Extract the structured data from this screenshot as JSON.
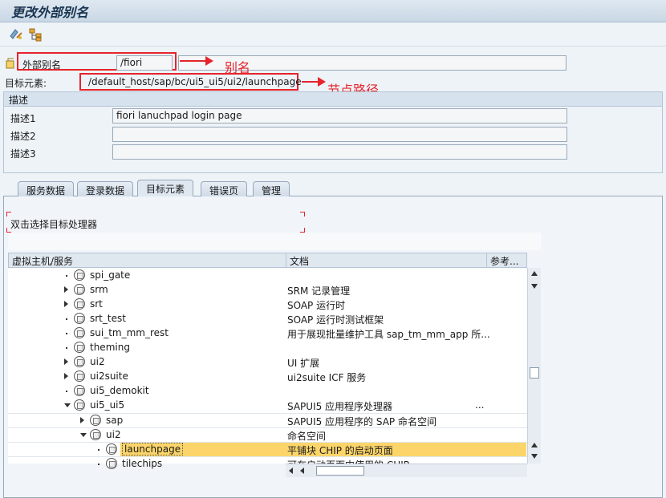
{
  "window": {
    "title": "更改外部别名"
  },
  "toolbar": {
    "icons": [
      "display-change-icon",
      "hierarchy-icon"
    ]
  },
  "alias": {
    "label": "外部别名",
    "value": "/fiori",
    "annotation": "别名"
  },
  "target": {
    "label": "目标元素:",
    "value": "/default_host/sap/bc/ui5_ui5/ui2/launchpage",
    "annotation": "节点路径"
  },
  "description": {
    "header": "描述",
    "rows": [
      {
        "label": "描述1",
        "value": "fiori lanuchpad login page"
      },
      {
        "label": "描述2",
        "value": ""
      },
      {
        "label": "描述3",
        "value": ""
      }
    ]
  },
  "tabs": [
    {
      "label": "服务数据",
      "active": false
    },
    {
      "label": "登录数据",
      "active": false
    },
    {
      "label": "目标元素",
      "active": true
    },
    {
      "label": "错误页",
      "active": false
    },
    {
      "label": "管理",
      "active": false
    }
  ],
  "panel": {
    "instruction": "双击选择目标处理器",
    "columns": [
      "虚拟主机/服务",
      "文档",
      "参考..."
    ],
    "tree": [
      {
        "name": "spi_gate",
        "doc": "",
        "level": 0,
        "toggle": "none"
      },
      {
        "name": "srm",
        "doc": "SRM 记录管理",
        "level": 0,
        "toggle": "collapsed"
      },
      {
        "name": "srt",
        "doc": "SOAP 运行时",
        "level": 0,
        "toggle": "collapsed"
      },
      {
        "name": "srt_test",
        "doc": "SOAP 运行时测试框架",
        "level": 0,
        "toggle": "none"
      },
      {
        "name": "sui_tm_mm_rest",
        "doc": "用于展现批量维护工具 sap_tm_mm_app 所...",
        "level": 0,
        "toggle": "none"
      },
      {
        "name": "theming",
        "doc": "",
        "level": 0,
        "toggle": "none"
      },
      {
        "name": "ui2",
        "doc": "UI 扩展",
        "level": 0,
        "toggle": "collapsed"
      },
      {
        "name": "ui2suite",
        "doc": "ui2suite ICF 服务",
        "level": 0,
        "toggle": "collapsed"
      },
      {
        "name": "ui5_demokit",
        "doc": "",
        "level": 0,
        "toggle": "none"
      },
      {
        "name": "ui5_ui5",
        "doc": "SAPUI5 应用程序处理器",
        "level": 0,
        "toggle": "expanded"
      },
      {
        "name": "sap",
        "doc": "SAPUI5 应用程序的 SAP 命名空间",
        "level": 1,
        "toggle": "collapsed"
      },
      {
        "name": "ui2",
        "doc": "命名空间",
        "level": 1,
        "toggle": "expanded"
      },
      {
        "name": "launchpage",
        "doc": "平铺块 CHIP 的启动页面",
        "level": 2,
        "toggle": "none",
        "selected": true
      },
      {
        "name": "tilechips",
        "doc": "可在启动页面中使用的 CHIP",
        "level": 2,
        "toggle": "none"
      }
    ],
    "ellipsis": "..."
  },
  "colors": {
    "accent": "#e6242b",
    "selected_row": "#fcd56a"
  }
}
